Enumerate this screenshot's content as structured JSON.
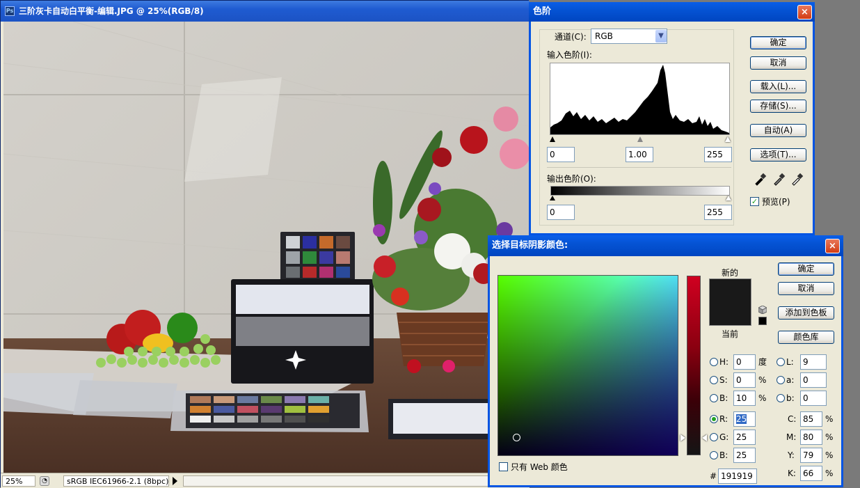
{
  "document": {
    "title": "三阶灰卡自动白平衡-编辑.JPG @ 25%(RGB/8)",
    "app_icon": "Ps",
    "status": {
      "zoom": "25%",
      "profile": "sRGB IEC61966-2.1 (8bpc)"
    }
  },
  "levels": {
    "title": "色阶",
    "close": "×",
    "channel_label": "通道(C):",
    "channel_value": "RGB",
    "input_label": "输入色阶(I):",
    "input_black": "0",
    "input_gamma": "1.00",
    "input_white": "255",
    "output_label": "输出色阶(O):",
    "output_black": "0",
    "output_white": "255",
    "buttons": {
      "ok": "确定",
      "cancel": "取消",
      "load": "载入(L)...",
      "save": "存储(S)...",
      "auto": "自动(A)",
      "options": "选项(T)..."
    },
    "preview_label": "预览(P)",
    "preview_checked": true,
    "histogram_icon": "histogram",
    "eyedroppers": [
      "black-eyedropper-icon",
      "gray-eyedropper-icon",
      "white-eyedropper-icon"
    ]
  },
  "picker": {
    "title": "选择目标阴影颜色:",
    "close": "×",
    "new_label": "新的",
    "current_label": "当前",
    "new_color": "#191919",
    "current_color": "#191919",
    "buttons": {
      "ok": "确定",
      "cancel": "取消",
      "add_swatch": "添加到色板",
      "libraries": "颜色库"
    },
    "fields": {
      "H": {
        "label": "H:",
        "value": "0",
        "unit": "度"
      },
      "S": {
        "label": "S:",
        "value": "0",
        "unit": "%"
      },
      "Bv": {
        "label": "B:",
        "value": "10",
        "unit": "%"
      },
      "R": {
        "label": "R:",
        "value": "25"
      },
      "G": {
        "label": "G:",
        "value": "25"
      },
      "Bc": {
        "label": "B:",
        "value": "25"
      },
      "L": {
        "label": "L:",
        "value": "9"
      },
      "a": {
        "label": "a:",
        "value": "0"
      },
      "b": {
        "label": "b:",
        "value": "0"
      },
      "C": {
        "label": "C:",
        "value": "85",
        "unit": "%"
      },
      "M": {
        "label": "M:",
        "value": "80",
        "unit": "%"
      },
      "Y": {
        "label": "Y:",
        "value": "79",
        "unit": "%"
      },
      "K": {
        "label": "K:",
        "value": "66",
        "unit": "%"
      }
    },
    "selected_mode": "R",
    "hex_label": "#",
    "hex_value": "191919",
    "web_only_label": "只有 Web 颜色",
    "web_only_checked": false
  },
  "colors": {
    "xp_blue": "#0054e3",
    "dialog_bg": "#ece9d8",
    "accent_green": "#21a121"
  }
}
